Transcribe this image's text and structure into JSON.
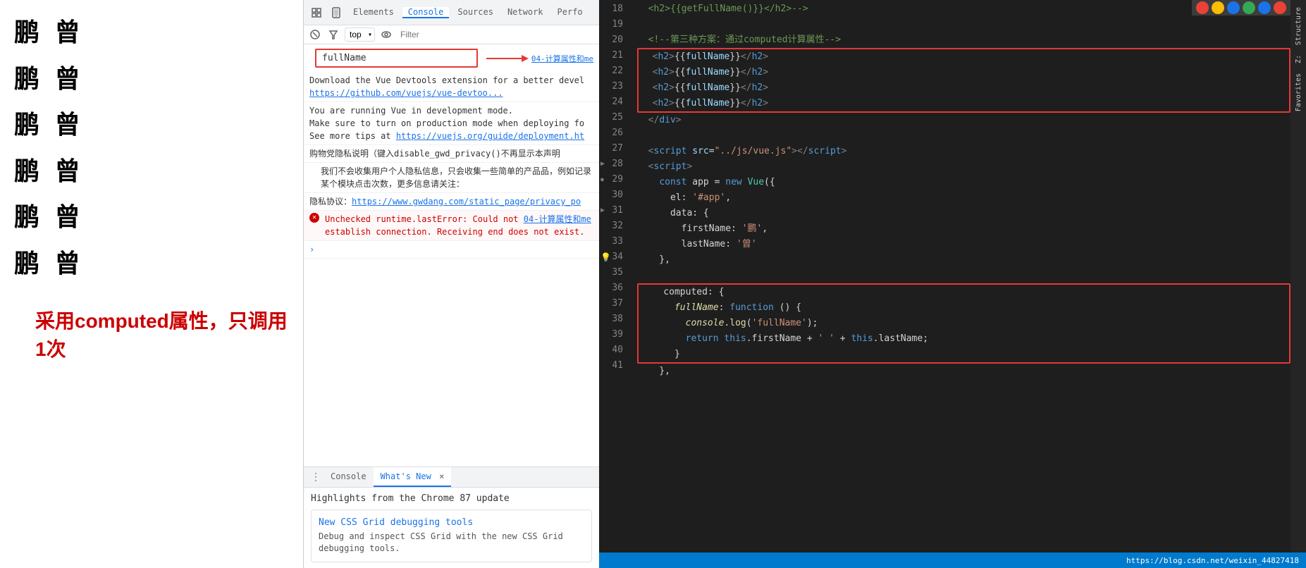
{
  "webpage": {
    "names": [
      {
        "chinese": "鹏 曾"
      },
      {
        "chinese": "鹏 曾"
      },
      {
        "chinese": "鹏 曾"
      },
      {
        "chinese": "鹏 曾"
      },
      {
        "chinese": "鹏 曾"
      },
      {
        "chinese": "鹏 曾"
      }
    ],
    "annotation": "采用computed属性，只调用1次"
  },
  "devtools": {
    "tabs": [
      {
        "label": "Elements",
        "active": false
      },
      {
        "label": "Console",
        "active": true
      },
      {
        "label": "Sources",
        "active": false
      },
      {
        "label": "Network",
        "active": false
      },
      {
        "label": "Perfo",
        "active": false
      }
    ],
    "console_selector": "top",
    "filter_placeholder": "Filter",
    "fullname_value": "fullName",
    "messages": [
      {
        "type": "normal",
        "text": "Download the Vue Devtools extension for a better devel",
        "link": "https://github.com/vuejs/vue-devtoo..."
      },
      {
        "type": "normal",
        "text1": "You are running Vue in development mode.",
        "text2": "Make sure to turn on production mode when deploying fo",
        "text3": "See more tips at ",
        "link": "https://vuejs.org/guide/deployment.ht"
      },
      {
        "type": "normal",
        "text": "购物党隐私说明（键入disable_gwd_privacy()不再显示本声明"
      },
      {
        "type": "normal",
        "text": "  我们不会收集用户个人隐私信息，只会收集一些简单的产品品，例如记录某个模块点击次数，更多信息请关注："
      },
      {
        "type": "normal",
        "text": "隐私协议：",
        "link": "https://www.gwdang.com/static_page/privacy_po"
      },
      {
        "type": "error",
        "text": "Unchecked runtime.lastError: Could not ",
        "link1": "04-计算属性和me",
        "text2": "establish connection. Receiving end does not exist."
      },
      {
        "type": "expand",
        "text": "›"
      }
    ],
    "bottom_tabs": [
      {
        "label": "Console",
        "active": false
      },
      {
        "label": "What's New",
        "active": true,
        "closeable": true
      }
    ],
    "whats_new": {
      "highlight": "Highlights from the Chrome 87 update",
      "card_title": "New CSS Grid debugging tools",
      "card_desc": "Debug and inspect CSS Grid with the new CSS Grid debugging tools."
    }
  },
  "code": {
    "lines": [
      {
        "num": 18,
        "content": "  <h2>{{getFullName()}}</h2>-->",
        "type": "html_comment"
      },
      {
        "num": 19,
        "content": "",
        "type": "blank"
      },
      {
        "num": 20,
        "content": "  <!--第三种方案：通过computed计算属性-->",
        "type": "comment"
      },
      {
        "num": 21,
        "content": "  <h2>{{fullName}}</h2>",
        "type": "html_red"
      },
      {
        "num": 22,
        "content": "  <h2>{{fullName}}</h2>",
        "type": "html_red"
      },
      {
        "num": 23,
        "content": "  <h2>{{fullName}}</h2>",
        "type": "html_red"
      },
      {
        "num": 24,
        "content": "  <h2>{{fullName}}</h2>",
        "type": "html_red"
      },
      {
        "num": 25,
        "content": "  </div>",
        "type": "html"
      },
      {
        "num": 26,
        "content": "",
        "type": "blank"
      },
      {
        "num": 27,
        "content": "  <script src=\"../js/vue.js\"><\\/script>",
        "type": "html"
      },
      {
        "num": 28,
        "content": "  <script>",
        "type": "html",
        "icon": "triangle"
      },
      {
        "num": 29,
        "content": "    const app = new Vue({",
        "type": "js",
        "icon": "dot"
      },
      {
        "num": 30,
        "content": "      el: '#app',",
        "type": "js"
      },
      {
        "num": 31,
        "content": "      data: {",
        "type": "js",
        "icon": "triangle"
      },
      {
        "num": 32,
        "content": "        firstName: '鹏',",
        "type": "js"
      },
      {
        "num": 33,
        "content": "        lastName: '曾'",
        "type": "js"
      },
      {
        "num": 34,
        "content": "    },",
        "type": "js",
        "icon": "lightbulb"
      },
      {
        "num": 35,
        "content": "",
        "type": "blank"
      },
      {
        "num": 36,
        "content": "    computed: {",
        "type": "js_red"
      },
      {
        "num": 37,
        "content": "      fullName: function () {",
        "type": "js_red"
      },
      {
        "num": 38,
        "content": "        console.log('fullName');",
        "type": "js_red"
      },
      {
        "num": 39,
        "content": "        return this.firstName + ' ' + this.lastName;",
        "type": "js_red"
      },
      {
        "num": 40,
        "content": "      }",
        "type": "js_red"
      },
      {
        "num": 41,
        "content": "    },",
        "type": "js"
      }
    ]
  },
  "sidebar_labels": [
    "Structure",
    "Z:",
    "Favorites"
  ],
  "status_url": "https://blog.csdn.net/weixin_44827418",
  "chrome_icons": [
    "🔴",
    "🟠",
    "🔵",
    "⚡",
    "🔵",
    "🔴"
  ]
}
